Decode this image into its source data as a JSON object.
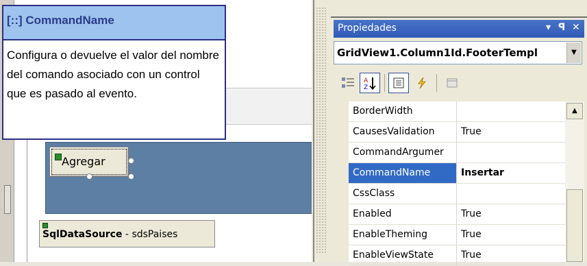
{
  "tooltip": {
    "title": "[::] CommandName",
    "description": "Configura o devuelve el valor del nombre del comando asociado con un control que es pasado al evento."
  },
  "designer": {
    "button_label": "Agregar",
    "datasource_type": "SqlDataSource",
    "datasource_sep": " - ",
    "datasource_name": "sdsPaises"
  },
  "properties": {
    "title": "Propiedades",
    "pin_glyph": "▾ ⊥ ✕",
    "object": "GridView1.Column1Id.FooterTempl",
    "rows": [
      {
        "name": "BorderWidth",
        "value": ""
      },
      {
        "name": "CausesValidation",
        "value": "True"
      },
      {
        "name": "CommandArgumer",
        "value": ""
      },
      {
        "name": "CommandName",
        "value": "Insertar",
        "selected": true
      },
      {
        "name": "CssClass",
        "value": ""
      },
      {
        "name": "Enabled",
        "value": "True"
      },
      {
        "name": "EnableTheming",
        "value": "True"
      },
      {
        "name": "EnableViewState",
        "value": "True"
      }
    ]
  },
  "colors": {
    "accent": "#316ac5",
    "tooltip_border": "#2b2e86",
    "panel": "#5d7fa3"
  }
}
